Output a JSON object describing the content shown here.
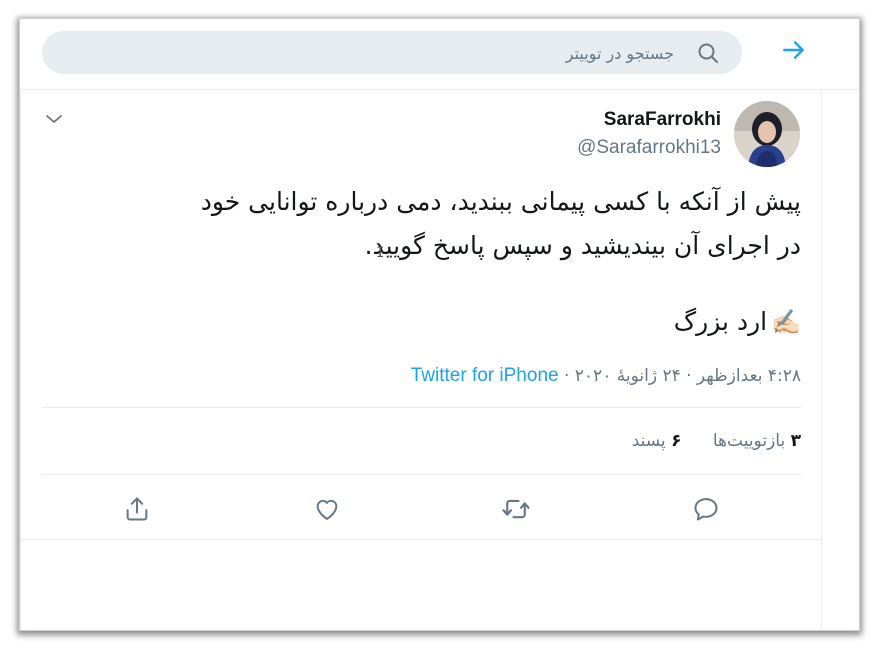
{
  "search": {
    "placeholder": "جستجو در توییتر"
  },
  "tweet": {
    "display_name": "SaraFarrokhi",
    "handle": "@Sarafarrokhi13",
    "text_line1": "پیش از آنکه با کسی پیمانی ببندید، دمی درباره توانایی خود",
    "text_line2": "در اجرای آن بیندیشید و سپس پاسخ گویید.",
    "signature": "ارد بزرگ",
    "signature_emoji": "✍🏻",
    "time": "۴:۲۸ بعدازظهر",
    "date": "۲۴ ژانویهٔ ۲۰۲۰",
    "source": "Twitter for iPhone",
    "separator": "·"
  },
  "stats": {
    "retweets_count": "۳",
    "retweets_label": "بازتوییت‌ها",
    "likes_count": "۶",
    "likes_label": "پسند"
  },
  "icons": {
    "back": "arrow-right-icon",
    "search": "search-icon",
    "more": "chevron-down-icon",
    "reply": "reply-icon",
    "retweet": "retweet-icon",
    "like": "heart-icon",
    "share": "share-icon"
  },
  "colors": {
    "accent": "#1da1f2",
    "secondary_text": "#657786",
    "primary_text": "#14171a",
    "search_bg": "#e6ecf0"
  }
}
